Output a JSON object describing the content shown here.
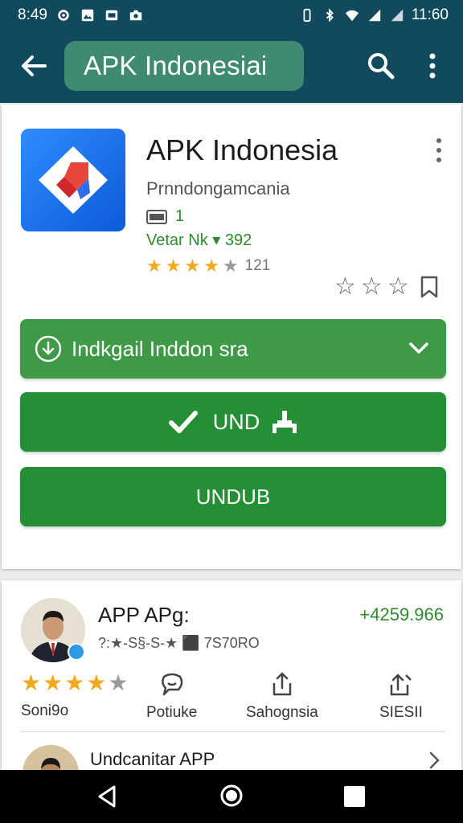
{
  "status_bar": {
    "time": "8:49",
    "clock_right": "11:60",
    "icons_left": [
      "gear-icon",
      "image-icon",
      "message-icon",
      "camera-icon"
    ],
    "icons_right": [
      "vibrate-icon",
      "bluetooth-icon",
      "wifi-icon",
      "signal-icon",
      "signal-icon"
    ]
  },
  "app_bar": {
    "search_text": "APK Indonesiai",
    "back_icon": "back-arrow-icon",
    "search_icon": "search-icon",
    "more_icon": "more-vert-icon",
    "background": "#104a5c",
    "pill_color": "#3e8a72"
  },
  "app": {
    "title": "APK Indonesia",
    "developer": "Prnndongamcania",
    "size_value": "1",
    "version": "Vetar Nk ▾ 392",
    "rating_count": "121",
    "stars_full": 4,
    "stars_total": 5
  },
  "buttons": {
    "select_label": "Indkgail Inddon sra",
    "und_label": "UND",
    "undub_label": "UNDUB",
    "green": "#258f35",
    "light_green": "#3e9a46"
  },
  "publisher": {
    "name": "APP APg:",
    "meta": "?:★-S§-S-★  ⬛ 7S70RO",
    "price": "+4259.966",
    "stars_full": 4,
    "stars_total": 5
  },
  "actions": {
    "first_label": "Soni9o",
    "items": [
      {
        "label": "Potiuke",
        "icon": "chat-icon"
      },
      {
        "label": "Sahognsia",
        "icon": "share-icon"
      },
      {
        "label": "SIESII",
        "icon": "upload-icon"
      }
    ]
  },
  "second_row": {
    "label": "Undcanitar APP"
  }
}
